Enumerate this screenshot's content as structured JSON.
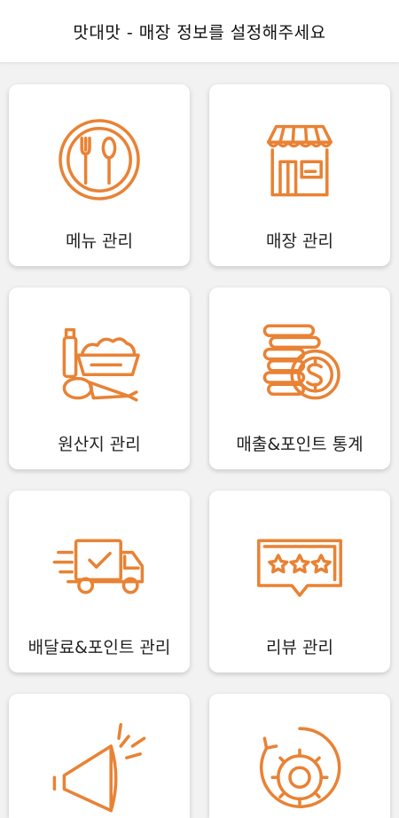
{
  "header": {
    "title": "맛대맛 - 매장 정보를 설정해주세요"
  },
  "colors": {
    "accent": "#e98234",
    "tile_bg": "#ffffff",
    "page_bg": "#f2f2f2"
  },
  "tiles": [
    {
      "label": "메뉴 관리",
      "icon": "plate-utensils-icon"
    },
    {
      "label": "매장 관리",
      "icon": "storefront-icon"
    },
    {
      "label": "원산지 관리",
      "icon": "groceries-icon"
    },
    {
      "label": "매출&포인트 통계",
      "icon": "coins-dollar-icon"
    },
    {
      "label": "배달료&포인트 관리",
      "icon": "delivery-truck-icon"
    },
    {
      "label": "리뷰 관리",
      "icon": "star-review-icon"
    },
    {
      "label": "",
      "icon": "megaphone-icon"
    },
    {
      "label": "",
      "icon": "gear-settings-icon"
    }
  ]
}
